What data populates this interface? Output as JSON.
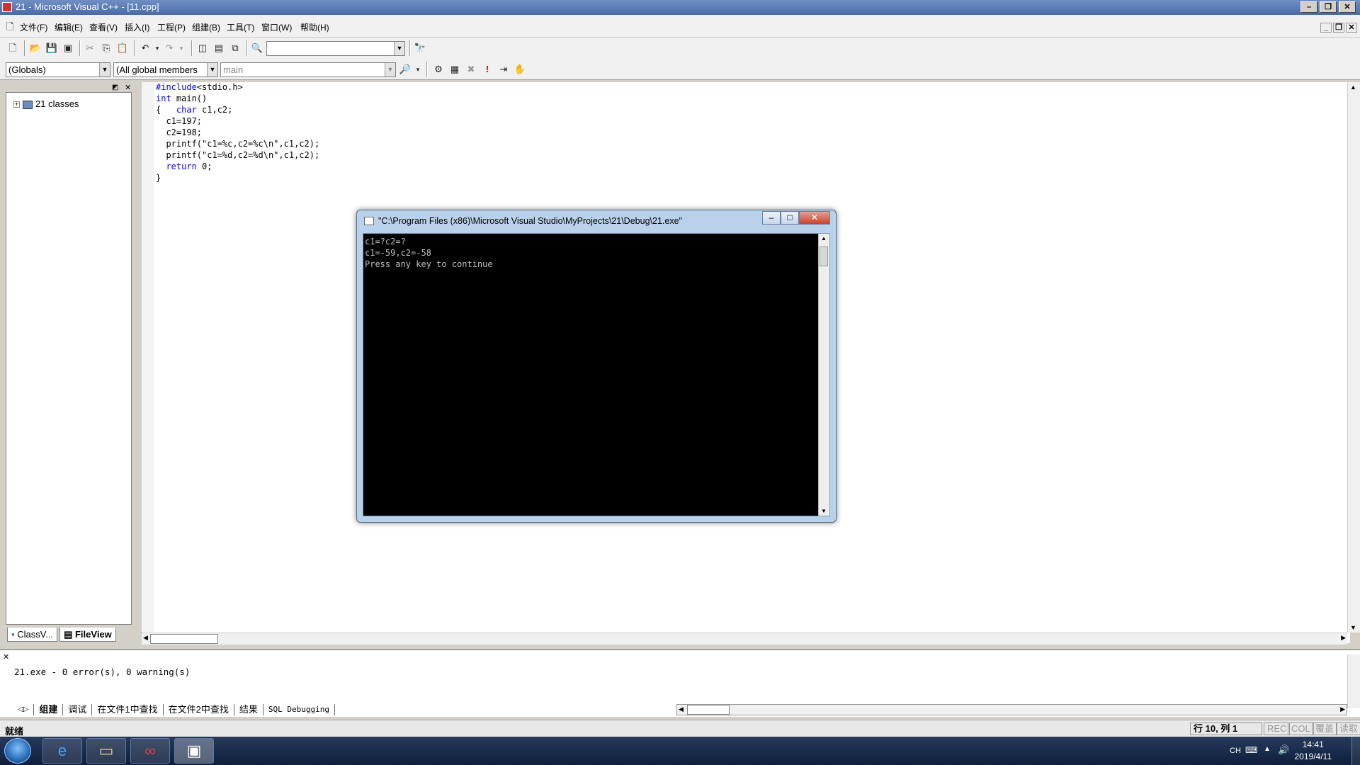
{
  "window": {
    "title": "21 - Microsoft Visual C++ - [11.cpp]"
  },
  "menu": [
    "文件(F)",
    "编辑(E)",
    "查看(V)",
    "插入(I)",
    "工程(P)",
    "组建(B)",
    "工具(T)",
    "窗口(W)",
    "帮助(H)"
  ],
  "toolbar": {
    "find_combo": ""
  },
  "wizardbar": {
    "scope": "(Globals)",
    "filter": "(All global members",
    "members": "main"
  },
  "workspace": {
    "tree_root": "21 classes",
    "tabs": [
      "ClassV...",
      "FileView"
    ]
  },
  "editor": {
    "lines": [
      {
        "pre": "",
        "kw": "#include",
        "post": "<stdio.h>"
      },
      {
        "pre": "",
        "kw": "int",
        "post": " main()"
      },
      {
        "pre": "{   ",
        "kw": "char",
        "post": " c1,c2;"
      },
      {
        "pre": "  c1=197;",
        "kw": "",
        "post": ""
      },
      {
        "pre": "  c2=198;",
        "kw": "",
        "post": ""
      },
      {
        "pre": "  printf(\"c1=%c,c2=%c\\n\",c1,c2);",
        "kw": "",
        "post": ""
      },
      {
        "pre": "  printf(\"c1=%d,c2=%d\\n\",c1,c2);",
        "kw": "",
        "post": ""
      },
      {
        "pre": "  ",
        "kw": "return",
        "post": " 0;"
      },
      {
        "pre": "}",
        "kw": "",
        "post": ""
      }
    ]
  },
  "console": {
    "title": "\"C:\\Program Files (x86)\\Microsoft Visual Studio\\MyProjects\\21\\Debug\\21.exe\"",
    "lines": [
      "c1=?c2=?",
      "c1=-59,c2=-58",
      "Press any key to continue"
    ]
  },
  "output": {
    "text": "21.exe - 0 error(s), 0 warning(s)",
    "tabs": [
      "组建",
      "调试",
      "在文件1中查找",
      "在文件2中查找",
      "结果",
      "SQL Debugging"
    ]
  },
  "status": {
    "ready": "就绪",
    "position": "行 10, 列 1",
    "rec": "REC",
    "col": "COL",
    "ovr": "覆盖",
    "read": "读取"
  },
  "taskbar": {
    "lang": "CH",
    "time": "14:41",
    "date": "2019/4/11"
  }
}
